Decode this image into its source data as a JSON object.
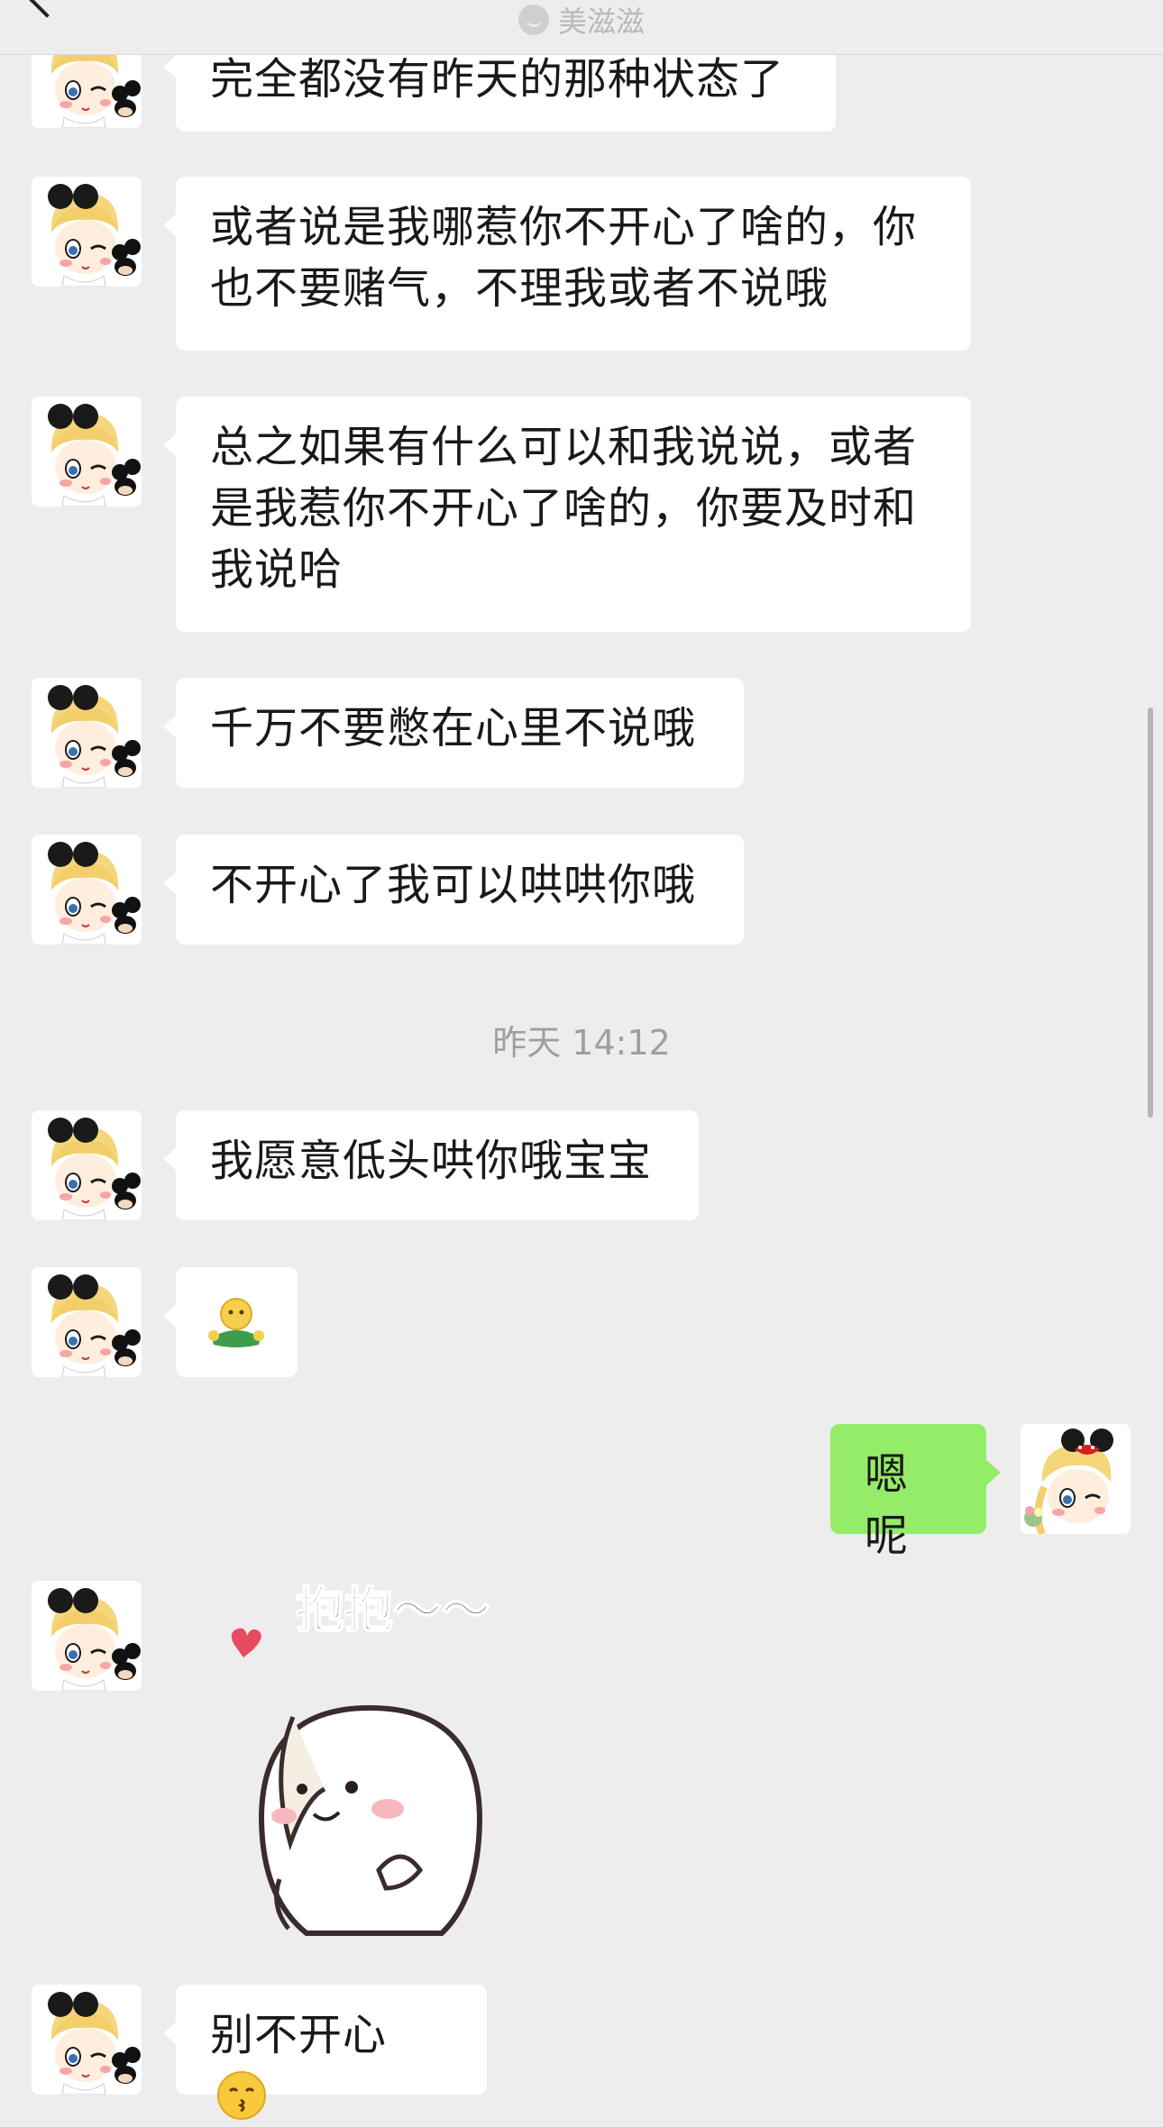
{
  "header": {
    "title": "美滋滋",
    "back_icon": "back-arrow-icon",
    "title_icon": "smiley-icon"
  },
  "messages": [
    {
      "side": "left",
      "text": "完全都没有昨天的那种状态了"
    },
    {
      "side": "left",
      "text": "或者说是我哪惹你不开心了啥的，你也不要赌气，不理我或者不说哦"
    },
    {
      "side": "left",
      "text": "总之如果有什么可以和我说说，或者是我惹你不开心了啥的，你要及时和我说哈"
    },
    {
      "side": "left",
      "text": "千万不要憋在心里不说哦"
    },
    {
      "side": "left",
      "text": "不开心了我可以哄哄你哦"
    },
    {
      "side": "left",
      "text": "我愿意低头哄你哦宝宝"
    },
    {
      "side": "left",
      "emoji": "hug-emoji"
    },
    {
      "side": "right",
      "text": "嗯呢"
    },
    {
      "side": "left",
      "sticker_text": "抱抱～～"
    },
    {
      "side": "left",
      "text": "别不开心",
      "emoji": "kissing-face-emoji"
    }
  ],
  "timestamp": "昨天 14:12",
  "colors": {
    "background": "#ededed",
    "left_bubble": "#ffffff",
    "right_bubble": "#95ec69"
  }
}
